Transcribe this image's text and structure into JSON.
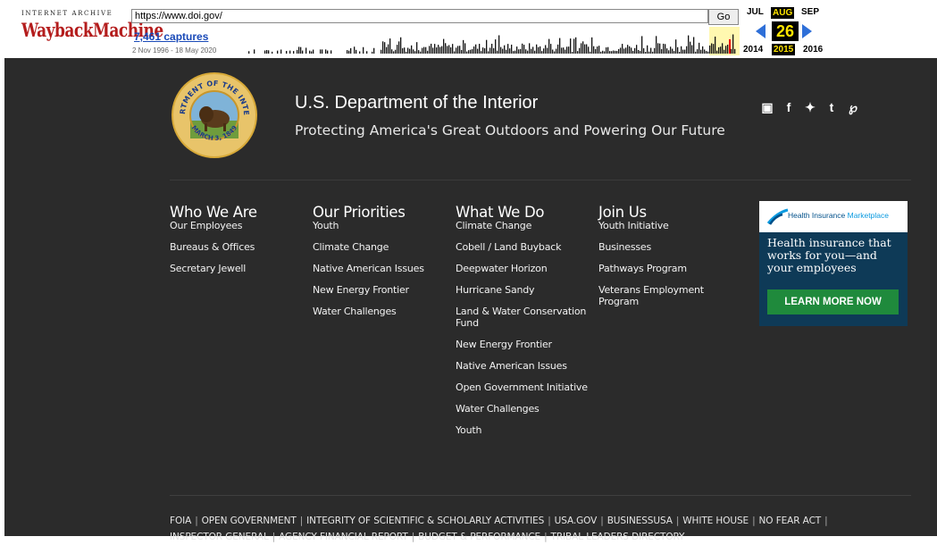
{
  "wayback": {
    "logo_top": "INTERNET ARCHIVE",
    "logo_main": "WaybackMachine",
    "url": "https://www.doi.gov/",
    "go_label": "Go",
    "captures": "7,461 captures",
    "range": "2 Nov 1996 - 18 May 2020",
    "months": {
      "prev": "JUL",
      "current": "AUG",
      "next": "SEP"
    },
    "day": "26",
    "years": {
      "prev": "2014",
      "current": "2015",
      "next": "2016"
    },
    "accent": "#ffe500",
    "arrow_color": "#2e6fd8"
  },
  "site": {
    "title": "U.S. Department of the Interior",
    "tagline": "Protecting America's Great Outdoors and Powering Our Future",
    "seal_text_top": "DEPARTMENT OF THE INTERIOR",
    "seal_text_bottom": "MARCH 3, 1849",
    "social_icons": [
      "instagram-icon",
      "facebook-icon",
      "twitter-icon",
      "tumblr-icon",
      "pinterest-icon"
    ],
    "background": "#2b2b2b"
  },
  "nav": {
    "columns": [
      {
        "heading": "Who We Are",
        "items": [
          "Our Employees",
          "Bureaus & Offices",
          "Secretary Jewell"
        ]
      },
      {
        "heading": "Our Priorities",
        "items": [
          "Youth",
          "Climate Change",
          "Native American Issues",
          "New Energy Frontier",
          "Water Challenges"
        ]
      },
      {
        "heading": "What We Do",
        "items": [
          "Climate Change",
          "Cobell / Land Buyback",
          "Deepwater Horizon",
          "Hurricane Sandy",
          "Land & Water Conservation Fund",
          "New Energy Frontier",
          "Native American Issues",
          "Open Government Initiative",
          "Water Challenges",
          "Youth"
        ]
      },
      {
        "heading": "Join Us",
        "items": [
          "Youth Initiative",
          "Businesses",
          "Pathways Program",
          "Veterans Employment Program"
        ]
      }
    ]
  },
  "ad": {
    "brand_a": "Health Insurance ",
    "brand_b": "Marketplace",
    "body": "Health insurance that works for you—and your employees",
    "button": "LEARN MORE NOW"
  },
  "footer": {
    "row1": [
      "FOIA",
      "OPEN GOVERNMENT",
      "INTEGRITY OF SCIENTIFIC & SCHOLARLY ACTIVITIES",
      "USA.GOV",
      "BUSINESSUSA",
      "WHITE HOUSE",
      "NO FEAR ACT",
      ""
    ],
    "row2": [
      "INSPECTOR GENERAL",
      "AGENCY FINANCIAL REPORT",
      "BUDGET & PERFORMANCE",
      "TRIBAL LEADERS DIRECTORY"
    ]
  }
}
